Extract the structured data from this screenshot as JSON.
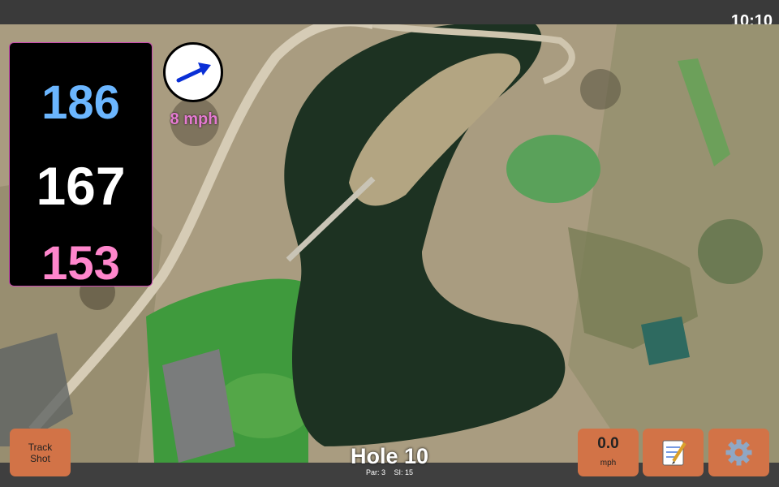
{
  "status_bar": {
    "time": "10:10"
  },
  "distances": {
    "back": "186",
    "middle": "167",
    "front": "153"
  },
  "wind": {
    "speed": "8 mph",
    "direction_icon": "arrow-up-right-icon"
  },
  "track_shot": {
    "line1": "Track",
    "line2": "Shot"
  },
  "hole": {
    "title": "Hole 10",
    "par": "Par: 3",
    "stroke_index": "SI: 15"
  },
  "speed": {
    "value": "0.0",
    "unit": "mph"
  },
  "buttons": {
    "notes_icon": "notepad-icon",
    "settings_icon": "gear-icon"
  },
  "colors": {
    "back": "#6bb6ff",
    "middle": "#ffffff",
    "front": "#ff86cc",
    "wind": "#e57bd1",
    "button": "#d27347"
  }
}
